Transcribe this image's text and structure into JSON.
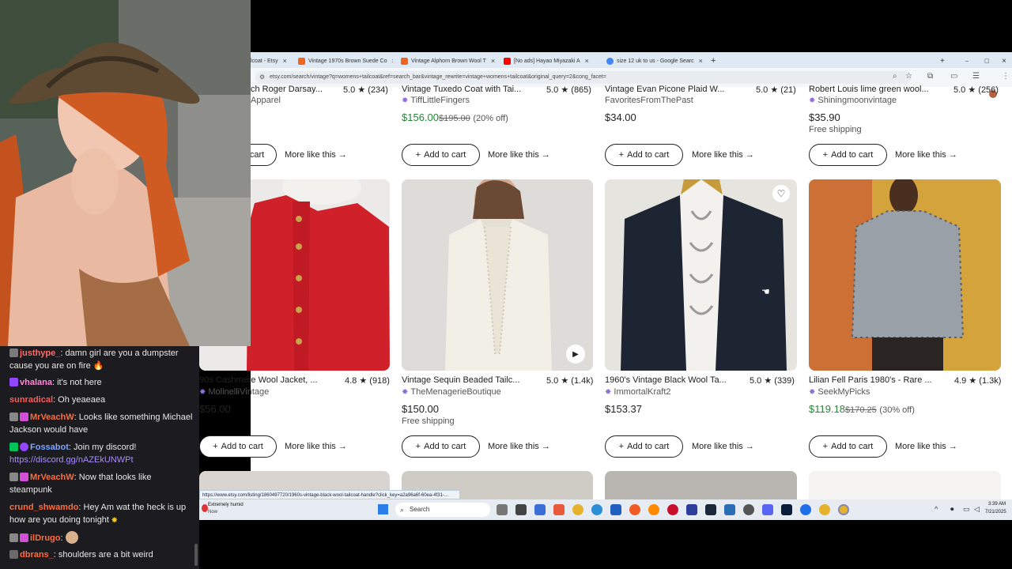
{
  "browser": {
    "tabs": [
      {
        "label": "lcoat - Etsy",
        "color": "#f1641e"
      },
      {
        "label": "Vintage 1970s Brown Suede Co",
        "color": "#f1641e"
      },
      {
        "label": "Vintage Alphorn Brown Wool T",
        "color": "#f1641e"
      },
      {
        "label": "[No ads] Hayao Miyazaki A",
        "color": "#ff0000"
      },
      {
        "label": "size 12 uk to us - Google Searc",
        "color": "#4285f4"
      }
    ],
    "url": "etsy.com/search/vintage?q=womens+tailcoat&ref=search_bar&vintage_rewrite=vintage+womens+tailcoat&original_query=2&cong_facet="
  },
  "products_top": [
    {
      "title": "ch Roger Darsay...",
      "rating": "5.0",
      "reviews": "(234)",
      "shop": "Apparel",
      "price": "",
      "add": "cart",
      "more": "More like this"
    },
    {
      "title": "Vintage Tuxedo Coat with Tai...",
      "rating": "5.0",
      "reviews": "(865)",
      "shop": "TiffLittleFingers",
      "price": "$156.00",
      "orig": "$195.00",
      "off": "(20% off)",
      "add": "Add to cart",
      "more": "More like this"
    },
    {
      "title": "Vintage Evan Picone Plaid W...",
      "rating": "5.0",
      "reviews": "(21)",
      "shop": "FavoritesFromThePast",
      "price": "$34.00",
      "add": "Add to cart",
      "more": "More like this"
    },
    {
      "title": "Robert Louis lime green wool...",
      "rating": "5.0",
      "reviews": "(256)",
      "shop": "Shiningmoonvintage",
      "price": "$35.90",
      "ship": "Free shipping",
      "add": "Add to cart",
      "more": "More like this"
    }
  ],
  "products": [
    {
      "title": "90s Cashmere Wool Jacket, ...",
      "rating": "4.8",
      "reviews": "(918)",
      "shop": "MolinelliVintage",
      "price": "$56.00",
      "add": "Add to cart",
      "more": "More like this"
    },
    {
      "title": "Vintage Sequin Beaded Tailc...",
      "rating": "5.0",
      "reviews": "(1.4k)",
      "shop": "TheMenagerieBoutique",
      "price": "$150.00",
      "ship": "Free shipping",
      "add": "Add to cart",
      "more": "More like this"
    },
    {
      "title": "1960's Vintage Black Wool Ta...",
      "rating": "5.0",
      "reviews": "(339)",
      "shop": "ImmortalKraft2",
      "price": "$153.37",
      "add": "Add to cart",
      "more": "More like this"
    },
    {
      "title": "Lilian Fell Paris 1980's - Rare ...",
      "rating": "4.9",
      "reviews": "(1.3k)",
      "shop": "SeekMyPicks",
      "price": "$119.18",
      "orig": "$170.25",
      "off": "(30% off)",
      "add": "Add to cart",
      "more": "More like this"
    }
  ],
  "status_url": "https://www.etsy.com/listing/1860497720/1960s-vintage-black-wool-tailcoat-handle?click_key=a2a96a6f-60ea-4f31-...",
  "taskbar": {
    "weather_title": "Extremely humid",
    "weather_sub": "Now",
    "search": "Search",
    "time": "3:39 AM",
    "date": "7/21/2025"
  },
  "chat": [
    {
      "user": "justhype_",
      "color": "#ff6b6b",
      "text": ": damn girl are you a dumpster cause you are on fire"
    },
    {
      "user": "vhalana",
      "color": "#ff8ad8",
      "text": ": it's not here"
    },
    {
      "user": "sunradical",
      "color": "#ff5a5a",
      "text": ": Oh yeaeaea"
    },
    {
      "user": "MrVeachW",
      "color": "#ff6b3d",
      "text": ": Looks like something Michael Jackson would have"
    },
    {
      "user": "Fossabot",
      "color": "#7aa6ff",
      "text": ": Join my discord!"
    },
    {
      "user": "",
      "color": "#a88cff",
      "text": "https://discord.gg/nAZEkUNWPt"
    },
    {
      "user": "MrVeachW",
      "color": "#ff6b3d",
      "text": ": Now that looks like steampunk"
    },
    {
      "user": "crund_shwamdo",
      "color": "#ff6b3d",
      "text": ": Hey Am wat the heck is up how are you doing tonight"
    },
    {
      "user": "ilDrugo",
      "color": "#ff6b3d",
      "text": ":"
    },
    {
      "user": "dbrans_",
      "color": "#ff6b3d",
      "text": ": shoulders are a bit weird"
    }
  ]
}
